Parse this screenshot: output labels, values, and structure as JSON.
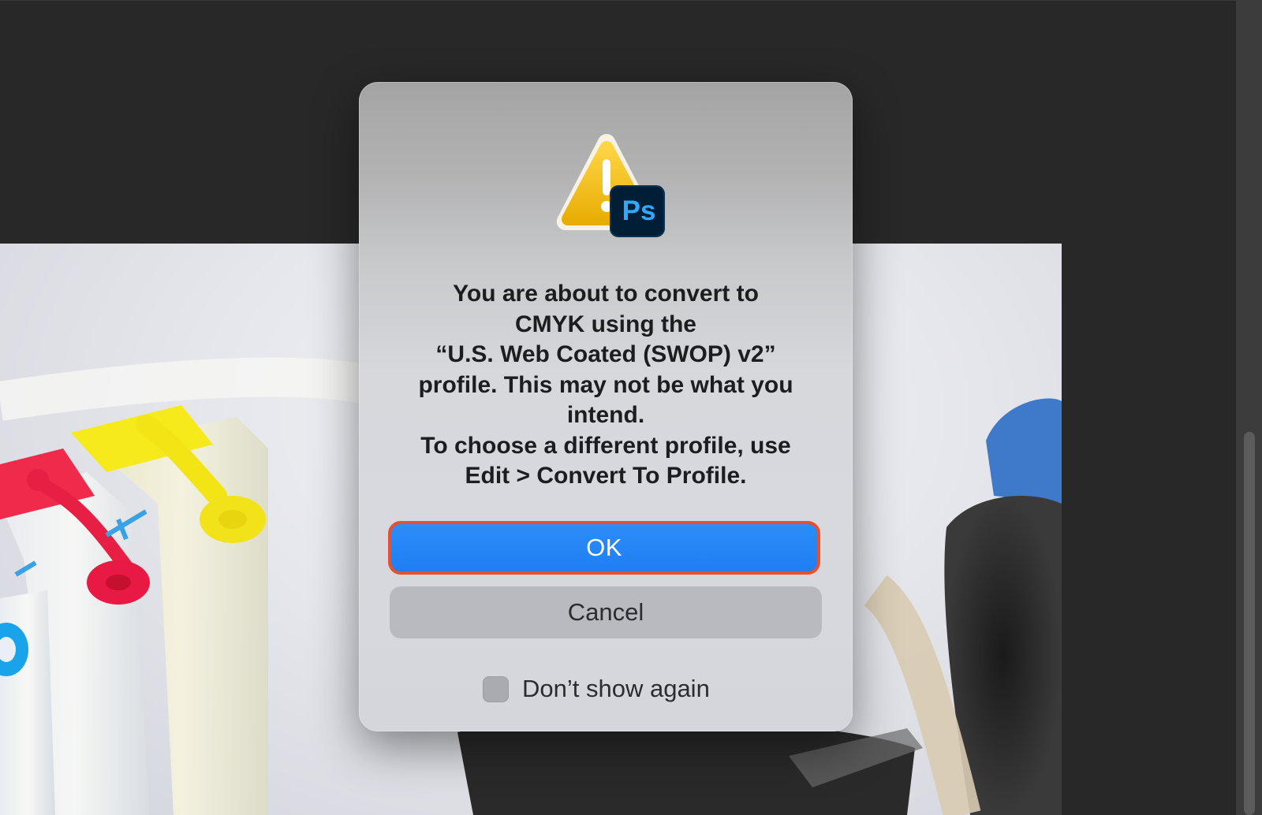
{
  "dialog": {
    "message_lines": [
      "You are about to convert to",
      "CMYK using the",
      "“U.S. Web Coated (SWOP) v2”",
      "profile. This may not be what you",
      "intend.",
      "To choose a different profile, use",
      "Edit > Convert To Profile."
    ],
    "icon_badge_text": "Ps",
    "ok_label": "OK",
    "cancel_label": "Cancel",
    "checkbox_label": "Don’t show again",
    "checkbox_checked": false
  },
  "icons": {
    "warning": "warning-triangle-icon",
    "badge": "photoshop-icon"
  },
  "colors": {
    "primary_button": "#1f7ef3",
    "focus_ring": "#e5512c",
    "warning_yellow": "#f2c200",
    "ps_badge_bg": "#001e36",
    "ps_badge_text": "#31a8ff"
  }
}
